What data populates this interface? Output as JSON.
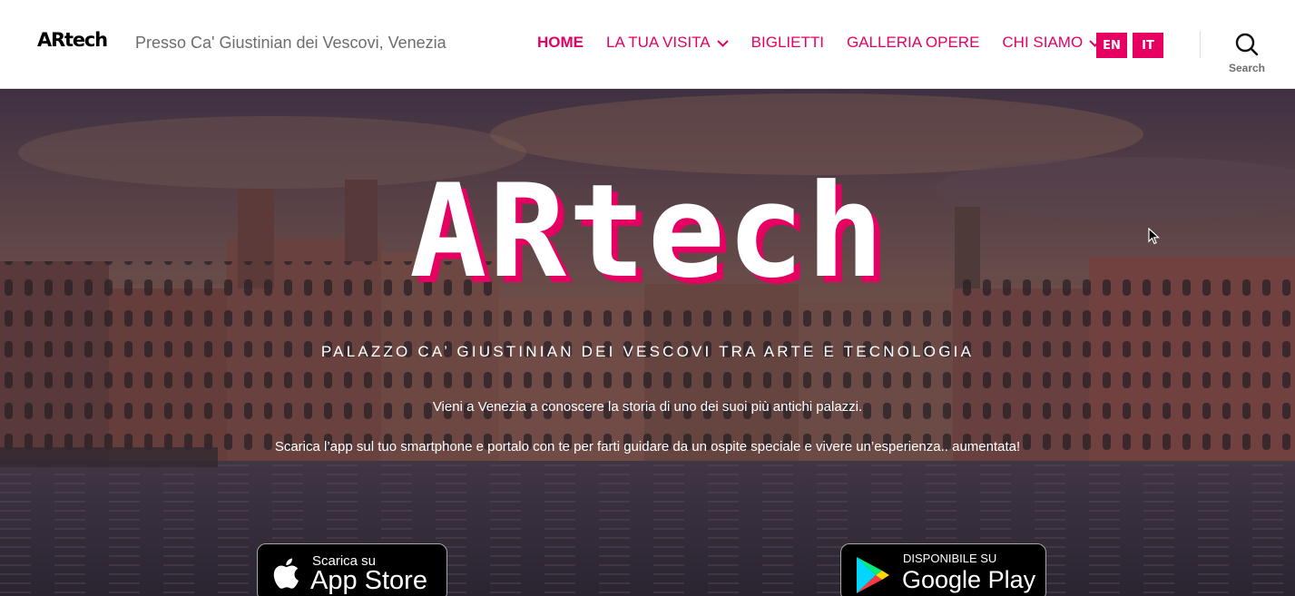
{
  "site": {
    "logo": "ARtech",
    "tagline": "Presso Ca' Giustinian dei Vescovi, Venezia"
  },
  "nav": {
    "items": [
      {
        "label": "HOME",
        "active": true,
        "has_dropdown": false
      },
      {
        "label": "LA TUA VISITA",
        "active": false,
        "has_dropdown": true
      },
      {
        "label": "BIGLIETTI",
        "active": false,
        "has_dropdown": false
      },
      {
        "label": "GALLERIA OPERE",
        "active": false,
        "has_dropdown": false
      },
      {
        "label": "CHI SIAMO",
        "active": false,
        "has_dropdown": true
      }
    ],
    "languages": [
      "EN",
      "IT"
    ],
    "search_label": "Search"
  },
  "hero": {
    "title": "ARtech",
    "subtitle": "PALAZZO CA’ GIUSTINIAN DEI VESCOVI TRA ARTE E TECNOLOGIA",
    "paragraph1": "Vieni a Venezia a conoscere la storia di uno dei suoi più antichi palazzi.",
    "paragraph2": "Scarica l’app sul tuo smartphone e portalo con te per farti guidare da un ospite speciale e vivere un’esperienza.. aumentata!",
    "background_icon": "venice-grand-canal-photo"
  },
  "stores": {
    "appstore": {
      "small": "Scarica su",
      "big": "App Store"
    },
    "googleplay": {
      "small": "DISPONIBILE SU",
      "big": "Google Play"
    }
  },
  "colors": {
    "accent": "#e60062",
    "header_bg": "#ffffff",
    "tagline": "#6d6d6d"
  }
}
